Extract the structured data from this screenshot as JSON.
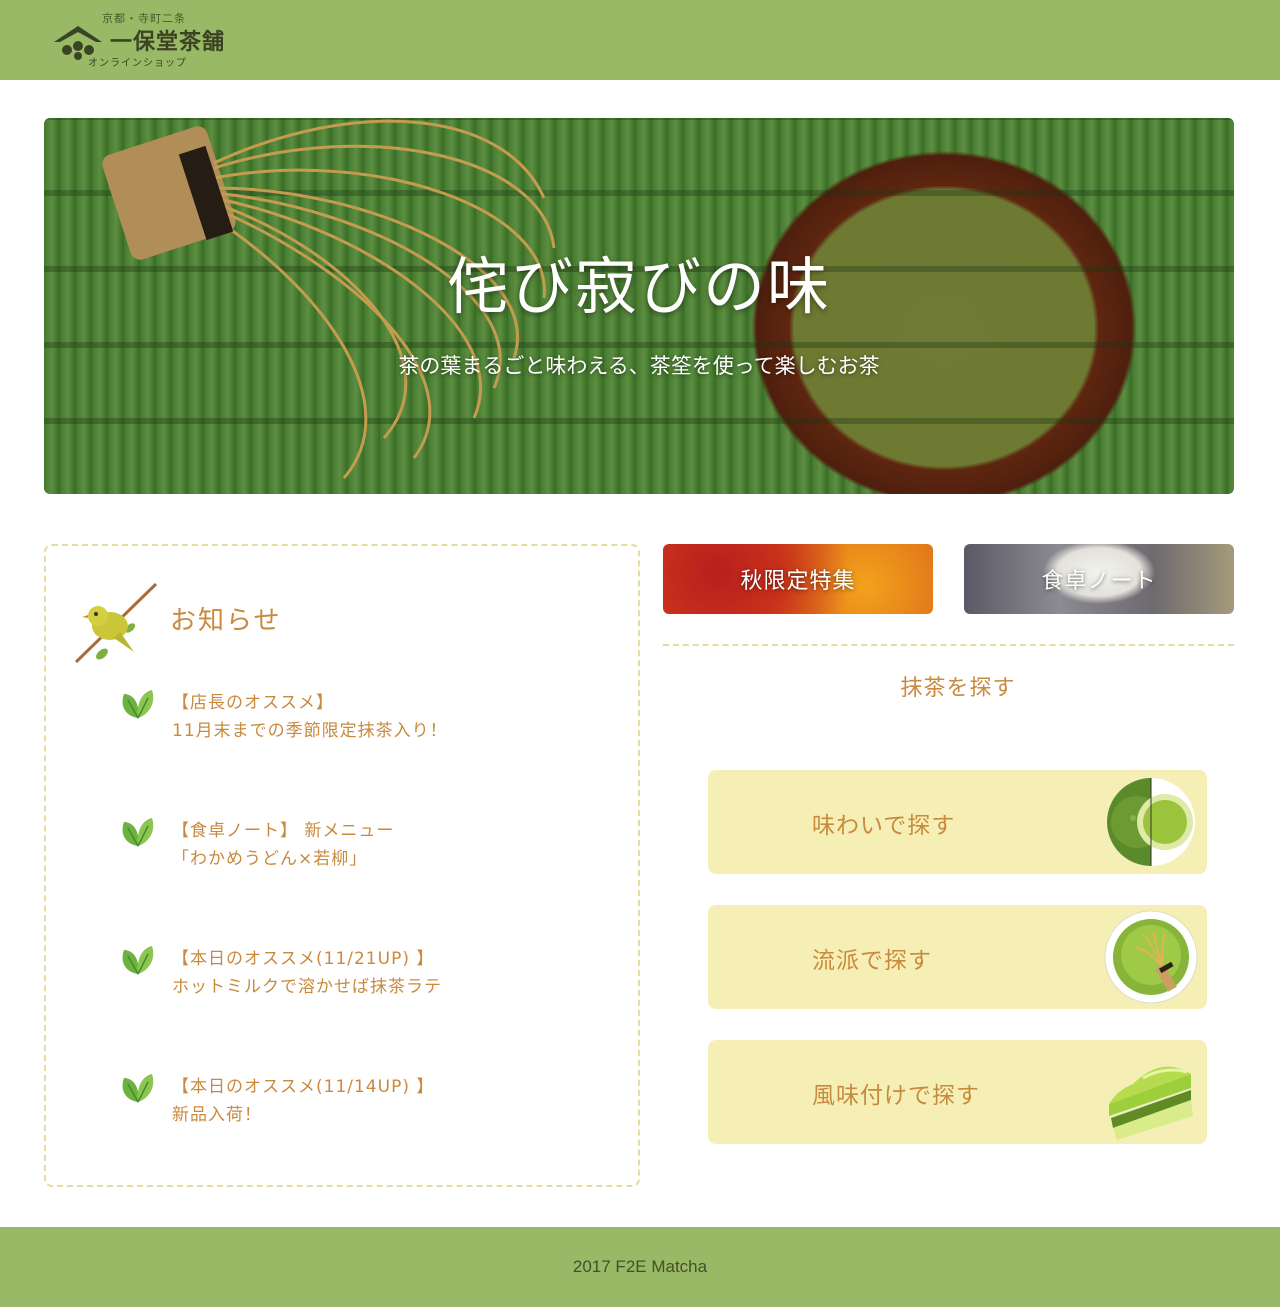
{
  "header": {
    "logo": {
      "top_text": "京都・寺町二条",
      "name": "一保堂茶舗",
      "bottom_text": "オンラインショップ"
    }
  },
  "hero": {
    "title": "侘び寂びの味",
    "subtitle": "茶の葉まるごと味わえる、茶筌を使って楽しむお茶"
  },
  "news": {
    "title": "お知らせ",
    "items": [
      {
        "line1": "【店長のオススメ】",
        "line2": "11月末までの季節限定抹茶入り！"
      },
      {
        "line1": "【食卓ノート】 新メニュー",
        "line2": "「わかめうどん×若柳」"
      },
      {
        "line1": "【本日のオススメ(11/21UP) 】",
        "line2": "ホットミルクで溶かせば抹茶ラテ"
      },
      {
        "line1": "【本日のオススメ(11/14UP) 】",
        "line2": "新品入荷！"
      }
    ]
  },
  "banners": {
    "autumn": "秋限定特集",
    "table_note": "食卓ノート"
  },
  "search": {
    "heading": "抹茶を探す",
    "buttons": [
      {
        "label": "味わいで探す",
        "icon": "matcha-bowl-icon"
      },
      {
        "label": "流派で探す",
        "icon": "tea-whisk-bowl-icon"
      },
      {
        "label": "風味付けで探す",
        "icon": "matcha-cake-icon"
      }
    ]
  },
  "footer": {
    "text": "2017 F2E Matcha"
  },
  "colors": {
    "header_bg": "#9ab966",
    "accent_text": "#c98a3e",
    "card_bg": "#f6efb5",
    "dashed_border": "#e6dc9e"
  }
}
